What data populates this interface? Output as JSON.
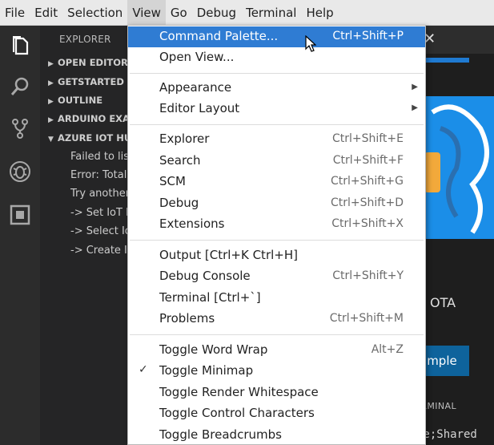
{
  "menubar": {
    "items": [
      "File",
      "Edit",
      "Selection",
      "View",
      "Go",
      "Debug",
      "Terminal",
      "Help"
    ],
    "active": "View"
  },
  "activity_bar": {
    "icons": [
      "explorer-icon",
      "search-icon",
      "source-control-icon",
      "debug-icon",
      "extensions-icon"
    ]
  },
  "sidebar": {
    "title": "EXPLORER",
    "sections": [
      "OPEN EDITORS",
      "GETSTARTED (W",
      "OUTLINE",
      "ARDUINO EXA",
      "AZURE IOT HUB"
    ],
    "azure_lines": [
      "Failed to lis",
      "Error: Total",
      "Try another",
      "-> Set IoT H",
      "-> Select Io",
      "-> Create Io"
    ]
  },
  "editor": {
    "ota_text": "OTA",
    "button_label": "ample",
    "terminal_label": "ERMINAL",
    "terminal_lines": [
      "me;Shared"
    ]
  },
  "view_menu": {
    "items": [
      {
        "label": "Command Palette...",
        "shortcut": "Ctrl+Shift+P",
        "highlighted": true
      },
      {
        "label": "Open View...",
        "shortcut": ""
      },
      {
        "label": "Appearance",
        "submenu": true
      },
      {
        "label": "Editor Layout",
        "submenu": true
      },
      {
        "label": "Explorer",
        "shortcut": "Ctrl+Shift+E"
      },
      {
        "label": "Search",
        "shortcut": "Ctrl+Shift+F"
      },
      {
        "label": "SCM",
        "shortcut": "Ctrl+Shift+G"
      },
      {
        "label": "Debug",
        "shortcut": "Ctrl+Shift+D"
      },
      {
        "label": "Extensions",
        "shortcut": "Ctrl+Shift+X"
      },
      {
        "label": "Output [Ctrl+K Ctrl+H]",
        "shortcut": ""
      },
      {
        "label": "Debug Console",
        "shortcut": "Ctrl+Shift+Y"
      },
      {
        "label": "Terminal [Ctrl+`]",
        "shortcut": ""
      },
      {
        "label": "Problems",
        "shortcut": "Ctrl+Shift+M"
      },
      {
        "label": "Toggle Word Wrap",
        "shortcut": "Alt+Z"
      },
      {
        "label": "Toggle Minimap",
        "shortcut": "",
        "checked": true
      },
      {
        "label": "Toggle Render Whitespace",
        "shortcut": ""
      },
      {
        "label": "Toggle Control Characters",
        "shortcut": ""
      },
      {
        "label": "Toggle Breadcrumbs",
        "shortcut": ""
      }
    ]
  },
  "colors": {
    "highlight": "#2f7cd3",
    "accent_blue": "#1b8ee8",
    "button_blue": "#0e639c"
  }
}
